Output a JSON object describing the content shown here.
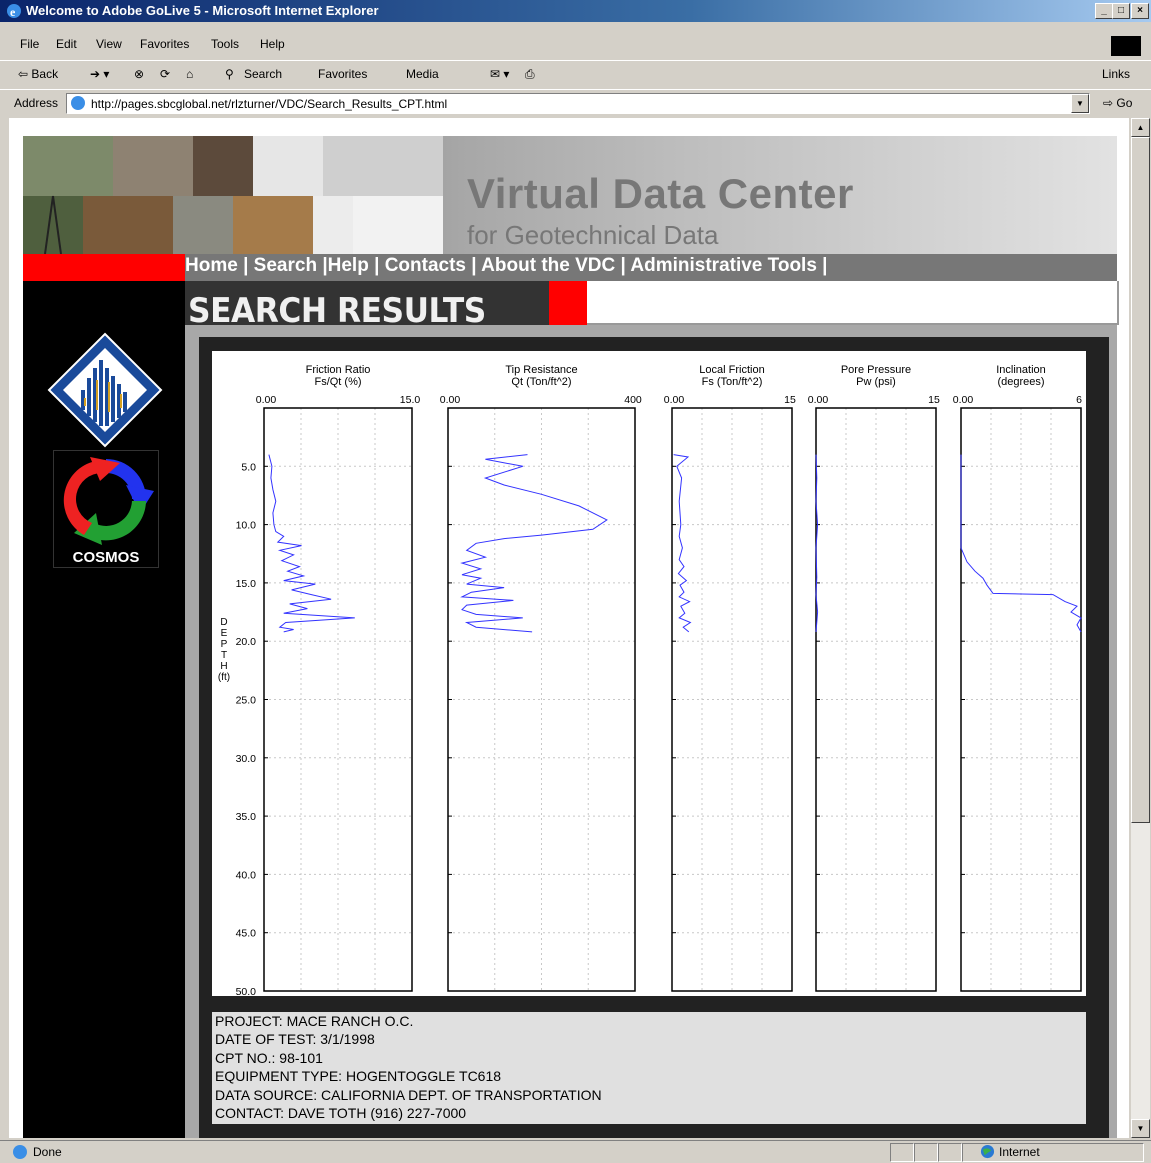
{
  "window": {
    "title": "Welcome to Adobe GoLive 5 - Microsoft Internet Explorer",
    "min": "_",
    "max": "□",
    "close": "×"
  },
  "menu": [
    "File",
    "Edit",
    "View",
    "Favorites",
    "Tools",
    "Help"
  ],
  "toolbar": {
    "back": "⇦ Back",
    "search": "Search",
    "favorites": "Favorites",
    "media": "Media",
    "links": "Links"
  },
  "address": {
    "label": "Address",
    "url": "http://pages.sbcglobal.net/rlzturner/VDC/Search_Results_CPT.html",
    "go": "Go"
  },
  "status": {
    "text": "Done",
    "zone": "Internet"
  },
  "page": {
    "title": "Virtual Data Center",
    "subtitle": "for Geotechnical Data",
    "nav": [
      "Home |",
      "Search |",
      "Help |",
      "Contacts |",
      "About the VDC |",
      "Administrative Tools |"
    ],
    "section_title": "SEARCH RESULTS",
    "cosmos_label": "COSMOS",
    "info": [
      "PROJECT: MACE RANCH O.C.",
      "DATE OF TEST: 3/1/1998",
      "CPT NO.: 98-101",
      "EQUIPMENT TYPE: HOGENTOGGLE TC618",
      "DATA SOURCE: CALIFORNIA DEPT. OF TRANSPORTATION",
      "CONTACT: DAVE TOTH (916) 227-7000"
    ]
  },
  "chart_data": {
    "type": "line",
    "depth_axis": {
      "label": "D E P T H (ft)",
      "ticks": [
        "5.0",
        "10.0",
        "15.0",
        "20.0",
        "25.0",
        "30.0",
        "35.0",
        "40.0",
        "45.0",
        "50.0"
      ],
      "range": [
        0,
        50
      ]
    },
    "panels": [
      {
        "title": "Friction Ratio",
        "units": "Fs/Qt (%)",
        "xmin_label": "0.00",
        "xmax_label": "15.0",
        "xlim": [
          0,
          15
        ],
        "color": "#3333ff",
        "points": [
          [
            0.5,
            4
          ],
          [
            0.8,
            5
          ],
          [
            0.7,
            6
          ],
          [
            0.9,
            7
          ],
          [
            1.2,
            8
          ],
          [
            0.9,
            9
          ],
          [
            1.0,
            10
          ],
          [
            1.2,
            10.6
          ],
          [
            2.0,
            11
          ],
          [
            1.4,
            11.5
          ],
          [
            3.8,
            11.8
          ],
          [
            1.6,
            12.2
          ],
          [
            3.0,
            12.6
          ],
          [
            1.8,
            13.1
          ],
          [
            3.6,
            13.6
          ],
          [
            2.4,
            14.0
          ],
          [
            4.0,
            14.4
          ],
          [
            2.0,
            14.8
          ],
          [
            5.2,
            15.1
          ],
          [
            2.8,
            15.6
          ],
          [
            4.8,
            16.0
          ],
          [
            6.8,
            16.4
          ],
          [
            2.6,
            16.8
          ],
          [
            4.4,
            17.2
          ],
          [
            2.0,
            17.6
          ],
          [
            9.2,
            18.0
          ],
          [
            2.2,
            18.4
          ],
          [
            1.6,
            18.8
          ],
          [
            3.0,
            19.0
          ],
          [
            2.0,
            19.2
          ]
        ]
      },
      {
        "title": "Tip Resistance",
        "units": "Qt (Ton/ft^2)",
        "xmin_label": "0.00",
        "xmax_label": "400",
        "xlim": [
          0,
          400
        ],
        "color": "#3333ff",
        "points": [
          [
            170,
            4
          ],
          [
            80,
            4.4
          ],
          [
            160,
            5
          ],
          [
            80,
            6
          ],
          [
            120,
            6.6
          ],
          [
            200,
            7.4
          ],
          [
            280,
            8.4
          ],
          [
            340,
            9.6
          ],
          [
            310,
            10.4
          ],
          [
            200,
            10.9
          ],
          [
            120,
            11.2
          ],
          [
            60,
            11.6
          ],
          [
            40,
            12.2
          ],
          [
            80,
            12.8
          ],
          [
            30,
            13.3
          ],
          [
            70,
            13.8
          ],
          [
            30,
            14.3
          ],
          [
            70,
            14.6
          ],
          [
            40,
            15.1
          ],
          [
            120,
            15.4
          ],
          [
            50,
            15.8
          ],
          [
            30,
            16.2
          ],
          [
            140,
            16.5
          ],
          [
            40,
            16.9
          ],
          [
            30,
            17.3
          ],
          [
            60,
            17.7
          ],
          [
            160,
            18.0
          ],
          [
            40,
            18.4
          ],
          [
            60,
            18.8
          ],
          [
            180,
            19.2
          ]
        ]
      },
      {
        "title": "Local Friction",
        "units": "Fs (Ton/ft^2)",
        "xmin_label": "0.00",
        "xmax_label": "15",
        "xlim": [
          0,
          15
        ],
        "color": "#3333ff",
        "points": [
          [
            0.2,
            4
          ],
          [
            2.0,
            4.2
          ],
          [
            0.6,
            5
          ],
          [
            1.2,
            6
          ],
          [
            0.9,
            8
          ],
          [
            1.1,
            10
          ],
          [
            0.9,
            11
          ],
          [
            1.3,
            12
          ],
          [
            0.9,
            13
          ],
          [
            1.5,
            13.6
          ],
          [
            0.8,
            14.2
          ],
          [
            1.8,
            14.8
          ],
          [
            1.0,
            15.2
          ],
          [
            1.5,
            15.8
          ],
          [
            0.9,
            16.2
          ],
          [
            2.2,
            16.6
          ],
          [
            1.1,
            17.0
          ],
          [
            1.6,
            17.6
          ],
          [
            0.9,
            18.0
          ],
          [
            2.3,
            18.4
          ],
          [
            1.4,
            18.8
          ],
          [
            2.1,
            19.2
          ]
        ]
      },
      {
        "title": "Pore Pressure",
        "units": "Pw (psi)",
        "xmin_label": "0.00",
        "xmax_label": "15",
        "xlim": [
          0,
          15
        ],
        "color": "#3333ff",
        "points": [
          [
            0,
            4
          ],
          [
            0.1,
            6
          ],
          [
            0,
            8
          ],
          [
            0.2,
            10
          ],
          [
            0,
            12
          ],
          [
            0.1,
            14.5
          ],
          [
            0,
            16
          ],
          [
            0.2,
            17.5
          ],
          [
            0,
            19.2
          ]
        ]
      },
      {
        "title": "Inclination",
        "units": "(degrees)",
        "xmin_label": "0.00",
        "xmax_label": "6",
        "xlim": [
          0,
          6
        ],
        "color": "#3333ff",
        "points": [
          [
            0,
            4
          ],
          [
            0,
            12.0
          ],
          [
            0.3,
            13.2
          ],
          [
            0.7,
            14.0
          ],
          [
            1.1,
            14.6
          ],
          [
            1.3,
            15.2
          ],
          [
            1.6,
            15.9
          ],
          [
            4.6,
            16.0
          ],
          [
            5.2,
            16.6
          ],
          [
            5.8,
            17.0
          ],
          [
            5.5,
            17.5
          ],
          [
            6.0,
            18.0
          ],
          [
            5.8,
            18.6
          ],
          [
            6.0,
            19.2
          ]
        ]
      }
    ]
  }
}
